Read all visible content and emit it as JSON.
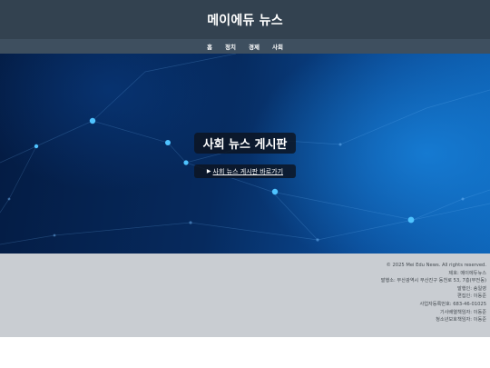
{
  "header": {
    "title": "메이에듀 뉴스"
  },
  "nav": {
    "items": [
      "홈",
      "정치",
      "경제",
      "사회"
    ]
  },
  "hero": {
    "title": "사회 뉴스 게시판",
    "link_icon": "▶",
    "link_text": "사회 뉴스 게시판 바로가기"
  },
  "footer": {
    "lines": [
      "© 2025 Mei Edu News. All rights reserved.",
      "제호: 메이에듀뉴스",
      "발행소: 부산광역시 부산진구 동천로 53, 7층(부전동)",
      "발행인: 송일영",
      "편집인: 이동준",
      "사업자등록번호: 683-46-01025",
      "기사배열책임자: 이동준",
      "청소년보호책임자: 이동준"
    ]
  },
  "colors": {
    "header_bg": "#334250",
    "nav_bg": "#3e4f5f",
    "footer_bg": "#c9cdd2",
    "hero_accent": "#4fc3ff"
  }
}
